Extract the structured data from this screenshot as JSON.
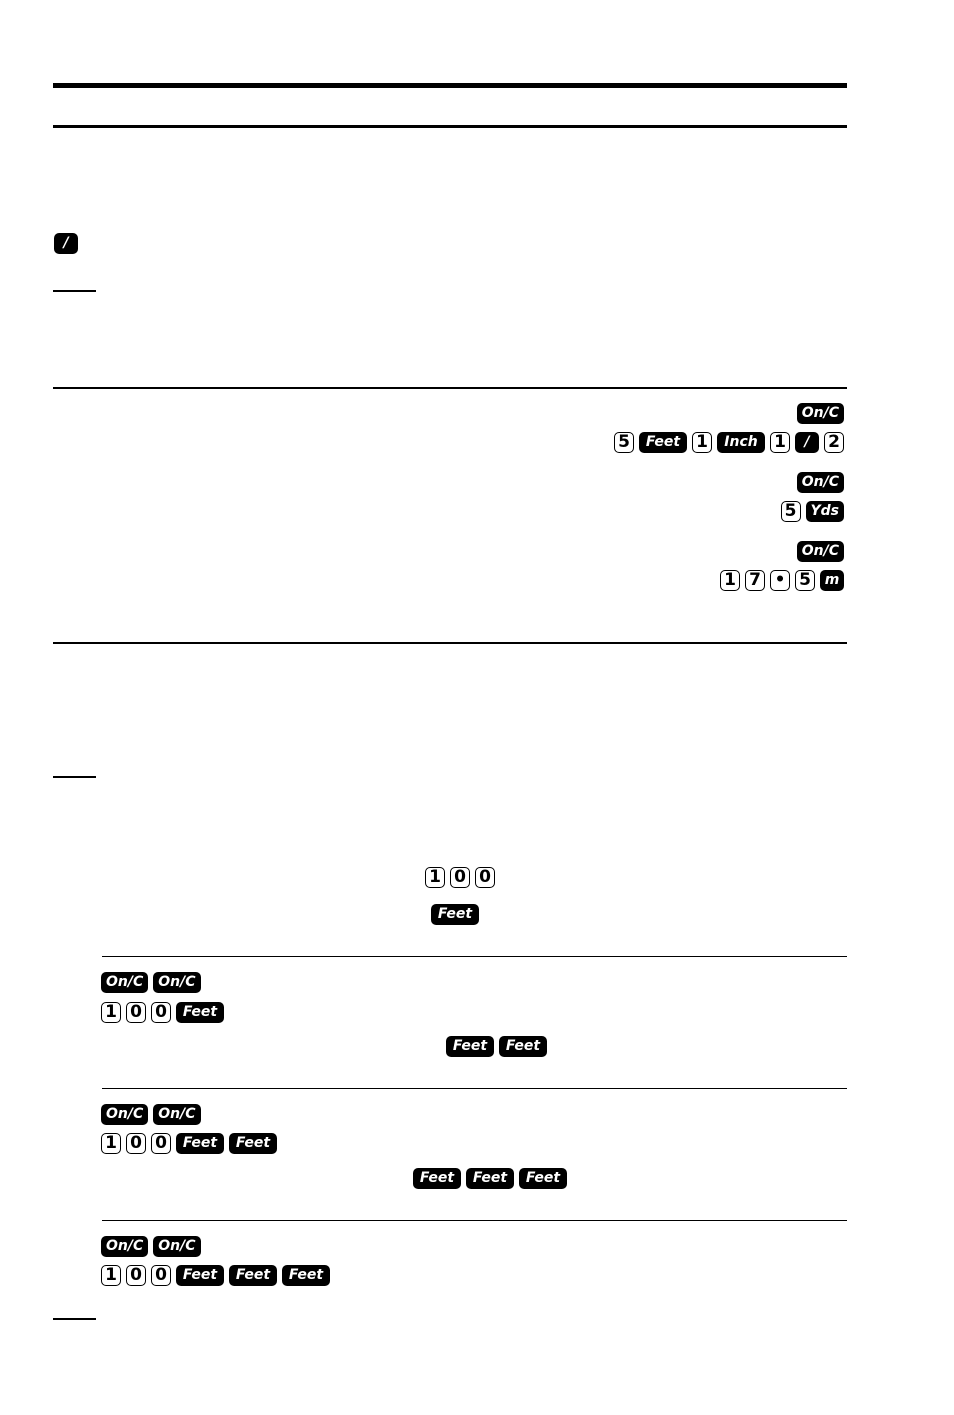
{
  "page": {
    "slash_key_label": "/",
    "examples": {
      "group1": {
        "row1": [
          "On/C"
        ],
        "row2": [
          "5",
          "Feet",
          "1",
          "Inch",
          "1",
          "/",
          "2"
        ]
      },
      "group2": {
        "row1": [
          "On/C"
        ],
        "row2": [
          "5",
          "Yds"
        ]
      },
      "group3": {
        "row1": [
          "On/C"
        ],
        "row2": [
          "1",
          "7",
          "•",
          "5",
          "m"
        ]
      }
    },
    "entry_keys": {
      "digits": [
        "1",
        "0",
        "0"
      ],
      "unit": [
        "Feet"
      ]
    },
    "steps": [
      {
        "clear": [
          "On/C",
          "On/C"
        ],
        "entry": [
          "1",
          "0",
          "0",
          "Feet"
        ],
        "press": [
          "Feet",
          "Feet"
        ]
      },
      {
        "clear": [
          "On/C",
          "On/C"
        ],
        "entry": [
          "1",
          "0",
          "0",
          "Feet",
          "Feet"
        ],
        "press": [
          "Feet",
          "Feet",
          "Feet"
        ]
      },
      {
        "clear": [
          "On/C",
          "On/C"
        ],
        "entry": [
          "1",
          "0",
          "0",
          "Feet",
          "Feet",
          "Feet"
        ]
      }
    ]
  }
}
